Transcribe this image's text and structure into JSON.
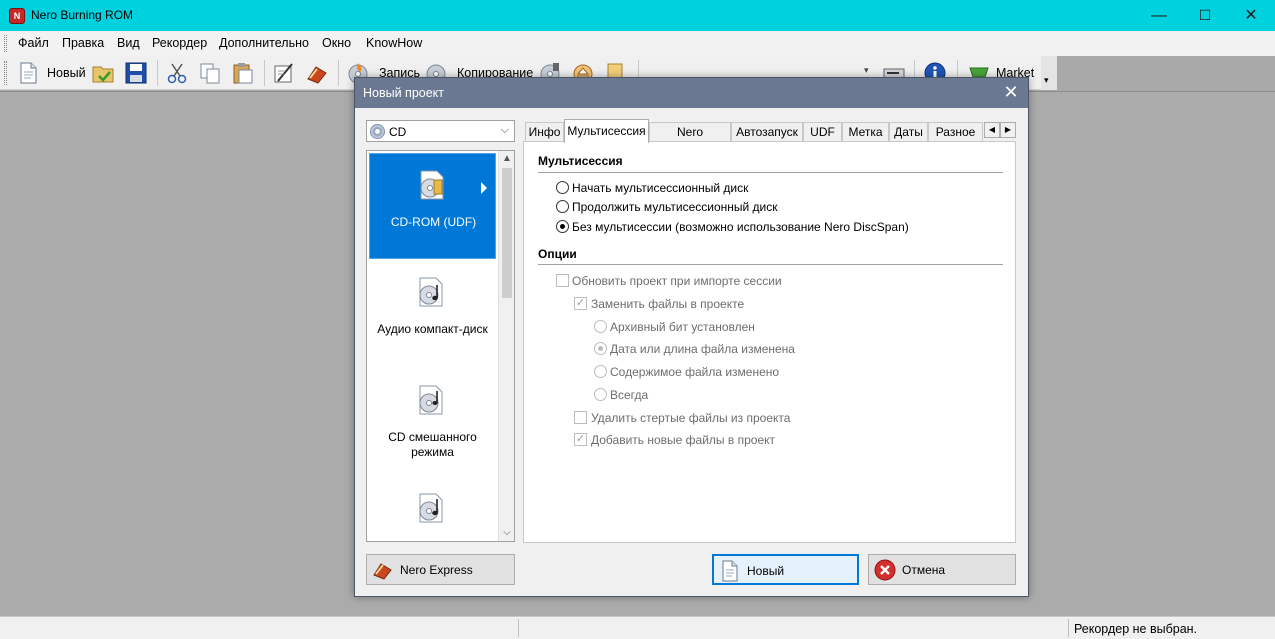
{
  "window": {
    "title": "Nero Burning ROM",
    "icon_name": "nero-app-icon",
    "controls": {
      "minimize": "—",
      "maximize": "☐",
      "close": "✕"
    }
  },
  "menu": {
    "items": [
      "Файл",
      "Правка",
      "Вид",
      "Рекордер",
      "Дополнительно",
      "Окно",
      "KnowHow"
    ]
  },
  "toolbar": {
    "new_label": "Новый",
    "burn_label": "Запись",
    "copy_label": "Копирование",
    "market_label": "Market"
  },
  "dialog": {
    "title": "Новый проект",
    "disc_type": {
      "value": "CD"
    },
    "project_types": [
      {
        "label": "CD-ROM (UDF)",
        "icon": "cd-rom-udf-icon",
        "selected": true
      },
      {
        "label": "Аудио компакт-диск",
        "icon": "audio-cd-icon",
        "selected": false
      },
      {
        "label": "CD смешанного режима",
        "icon": "mixed-mode-cd-icon",
        "selected": false
      },
      {
        "label": "",
        "icon": "cd-extra-icon",
        "selected": false
      }
    ],
    "tabs": [
      "Инфо",
      "Мультисессия",
      "Nero DiscSpan",
      "Автозапуск",
      "UDF",
      "Метка",
      "Даты",
      "Разное"
    ],
    "active_tab": "Мультисессия",
    "multisession": {
      "section_title": "Мультисессия",
      "options": [
        {
          "label": "Начать мультисессионный диск",
          "checked": false
        },
        {
          "label": "Продолжить мультисессионный диск",
          "checked": false
        },
        {
          "label": "Без мультисессии (возможно использование Nero DiscSpan)",
          "checked": true
        }
      ]
    },
    "options": {
      "section_title": "Опции",
      "update_project": {
        "label": "Обновить проект при импорте сессии",
        "checked": false
      },
      "replace_files": {
        "label": "Заменить файлы в проекте",
        "checked": true
      },
      "replace_conditions": [
        {
          "label": "Архивный бит установлен",
          "checked": false
        },
        {
          "label": "Дата или длина файла изменена",
          "checked": true
        },
        {
          "label": "Содержимое файла изменено",
          "checked": false
        },
        {
          "label": "Всегда",
          "checked": false
        }
      ],
      "remove_deleted": {
        "label": "Удалить стертые файлы из проекта",
        "checked": false
      },
      "add_new": {
        "label": "Добавить новые файлы в проект",
        "checked": true
      }
    },
    "buttons": {
      "nero_express": "Nero Express",
      "new": "Новый",
      "cancel": "Отмена"
    }
  },
  "statusbar": {
    "recorder_status": "Рекордер не выбран."
  },
  "colors": {
    "titlebar": "#00d1de",
    "dialog_titlebar": "#6a7891",
    "selection": "#0078d7"
  }
}
